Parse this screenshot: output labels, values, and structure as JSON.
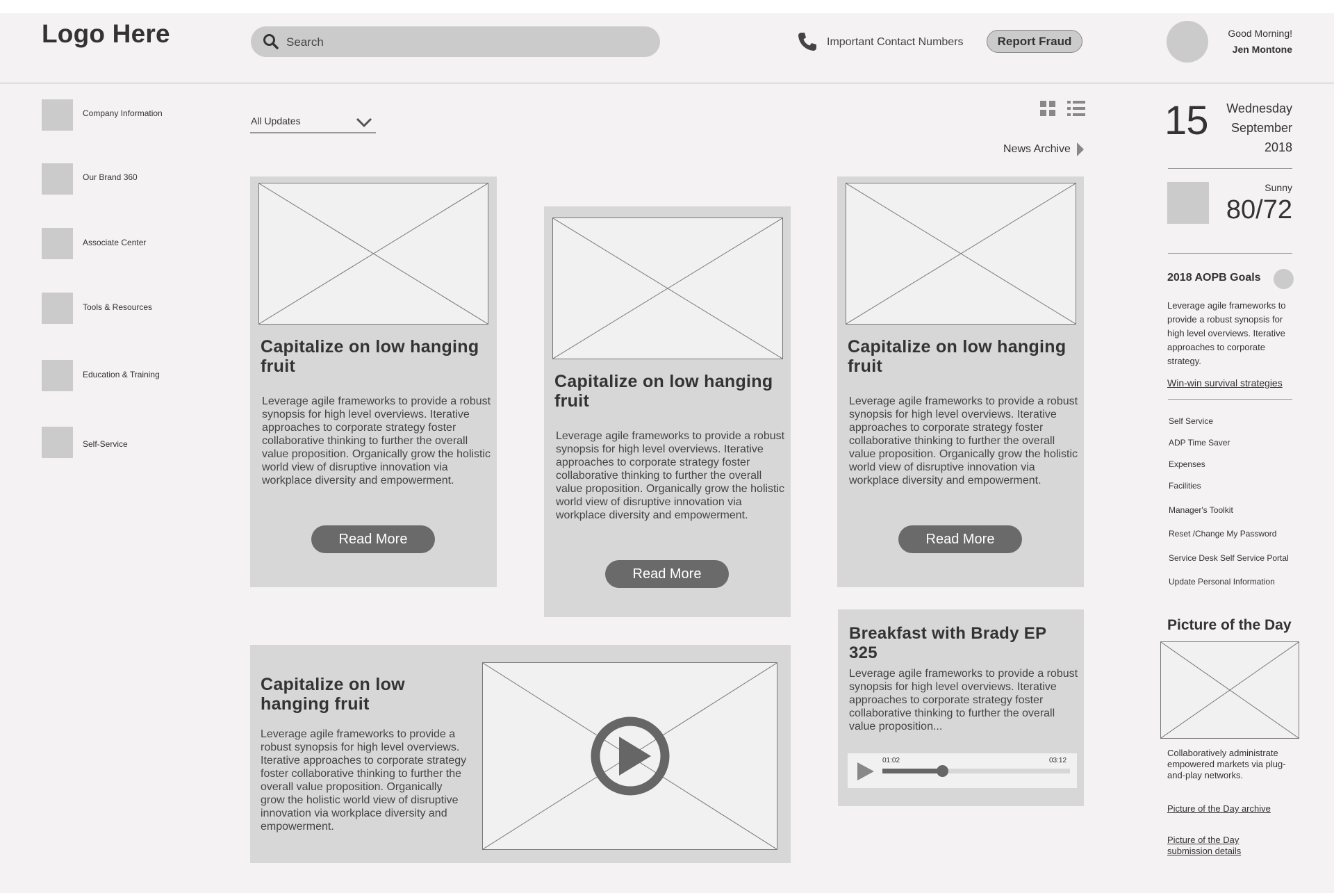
{
  "header": {
    "logo": "Logo Here",
    "search_placeholder": "Search",
    "contact_label": "Important Contact Numbers",
    "report_fraud": "Report Fraud",
    "greeting": "Good Morning!",
    "user_name": "Jen Montone"
  },
  "sidebar": {
    "items": [
      {
        "label": "Company Information"
      },
      {
        "label": "Our Brand 360"
      },
      {
        "label": "Associate Center"
      },
      {
        "label": "Tools & Resources"
      },
      {
        "label": "Education & Training"
      },
      {
        "label": "Self-Service"
      }
    ]
  },
  "main": {
    "filter_value": "All Updates",
    "archive_label": "News Archive",
    "cards": [
      {
        "title": "Capitalize on low hanging fruit",
        "body": "Leverage agile frameworks to provide a robust synopsis for high level overviews. Iterative approaches to corporate strategy foster collaborative thinking to further the overall value proposition. Organically grow the holistic world view of disruptive innovation via workplace diversity and empowerment.",
        "button": "Read More"
      },
      {
        "title": "Capitalize on low hanging fruit",
        "body": "Leverage agile frameworks to provide a robust synopsis for high level overviews. Iterative approaches to corporate strategy foster collaborative thinking to further the overall value proposition. Organically grow the holistic world view of disruptive innovation via workplace diversity and empowerment.",
        "button": "Read More"
      },
      {
        "title": "Capitalize on low hanging fruit",
        "body": "Leverage agile frameworks to provide a robust synopsis for high level overviews. Iterative approaches to corporate strategy foster collaborative thinking to further the overall value proposition. Organically grow the holistic world view of disruptive innovation via workplace diversity and empowerment.",
        "button": "Read More"
      }
    ],
    "video_card": {
      "title": "Capitalize on low hanging fruit",
      "body": "Leverage agile frameworks to provide a robust synopsis for high level overviews. Iterative approaches to corporate strategy foster collaborative thinking to further the overall value proposition. Organically grow the holistic world view of disruptive innovation via workplace diversity and empowerment."
    },
    "podcast_card": {
      "title": "Breakfast with Brady EP 325",
      "body": "Leverage agile frameworks to provide a robust synopsis for high level overviews. Iterative approaches to corporate strategy foster collaborative thinking to further the overall value proposition...",
      "current_time": "01:02",
      "duration": "03:12",
      "progress": 0.32
    }
  },
  "right": {
    "day": "15",
    "weekday": "Wednesday",
    "month": "September",
    "year": "2018",
    "weather": "Sunny",
    "temp": "80/72",
    "goals_title": "2018 AOPB Goals",
    "goals_body": "Leverage agile frameworks to provide a robust synopsis for high level overviews. Iterative approaches to corporate strategy.",
    "goals_link": "Win-win survival strategies",
    "links": [
      "Self Service",
      "ADP Time Saver",
      "Expenses",
      "Facilities",
      "Manager's Toolkit",
      "Reset /Change My Password",
      "Service Desk Self Service Portal",
      "Update Personal Information"
    ],
    "potd_title": "Picture of the Day",
    "potd_body": "Collaboratively administrate empowered markets via plug-and-play networks.",
    "potd_archive": "Picture of the Day archive",
    "potd_submission": "Picture of the Day submission details"
  },
  "colors": {
    "page_bg": "#f4f2f3",
    "card_bg": "#d7d7d7",
    "button_bg": "#6a6a6a",
    "placeholder_gray": "#cbcbcb"
  }
}
